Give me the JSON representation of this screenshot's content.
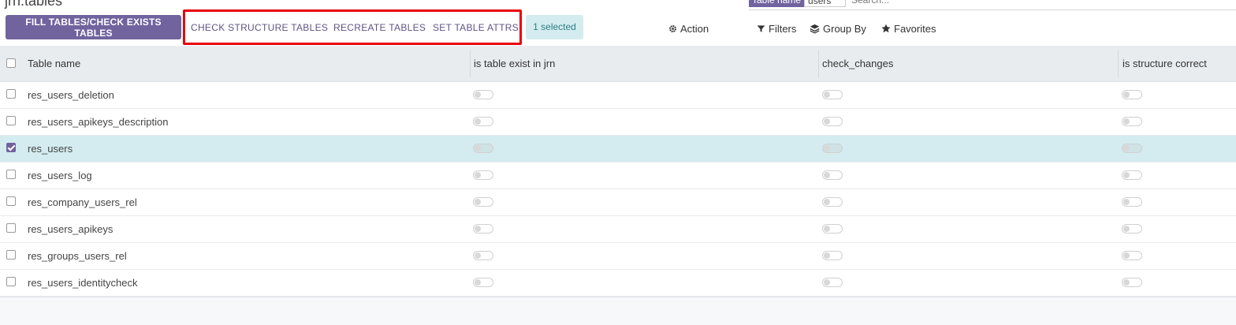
{
  "page": {
    "title": "jrn.tables"
  },
  "search": {
    "facet_label": "Table name",
    "facet_value": "users",
    "placeholder": "Search..."
  },
  "toolbar": {
    "fill_label": "FILL TABLES/CHECK EXISTS TABLES",
    "check_structure_label": "CHECK STRUCTURE TABLES",
    "recreate_label": "RECREATE TABLES",
    "set_attrs_label": "SET TABLE ATTRS",
    "selected_label": "1 selected",
    "action_label": "Action",
    "filters_label": "Filters",
    "groupby_label": "Group By",
    "favorites_label": "Favorites"
  },
  "table": {
    "columns": [
      "Table name",
      "is table exist in jrn",
      "check_changes",
      "is structure correct"
    ],
    "rows": [
      {
        "name": "res_users_deletion",
        "selected": false,
        "exists": false,
        "check_changes": false,
        "structure_correct": false
      },
      {
        "name": "res_users_apikeys_description",
        "selected": false,
        "exists": false,
        "check_changes": false,
        "structure_correct": false
      },
      {
        "name": "res_users",
        "selected": true,
        "exists": false,
        "check_changes": false,
        "structure_correct": false
      },
      {
        "name": "res_users_log",
        "selected": false,
        "exists": false,
        "check_changes": false,
        "structure_correct": false
      },
      {
        "name": "res_company_users_rel",
        "selected": false,
        "exists": false,
        "check_changes": false,
        "structure_correct": false
      },
      {
        "name": "res_users_apikeys",
        "selected": false,
        "exists": false,
        "check_changes": false,
        "structure_correct": false
      },
      {
        "name": "res_groups_users_rel",
        "selected": false,
        "exists": false,
        "check_changes": false,
        "structure_correct": false
      },
      {
        "name": "res_users_identitycheck",
        "selected": false,
        "exists": false,
        "check_changes": false,
        "structure_correct": false
      }
    ]
  },
  "colors": {
    "primary": "#71639e",
    "highlight": "#e8000b",
    "selected_row": "#d4ecef"
  }
}
